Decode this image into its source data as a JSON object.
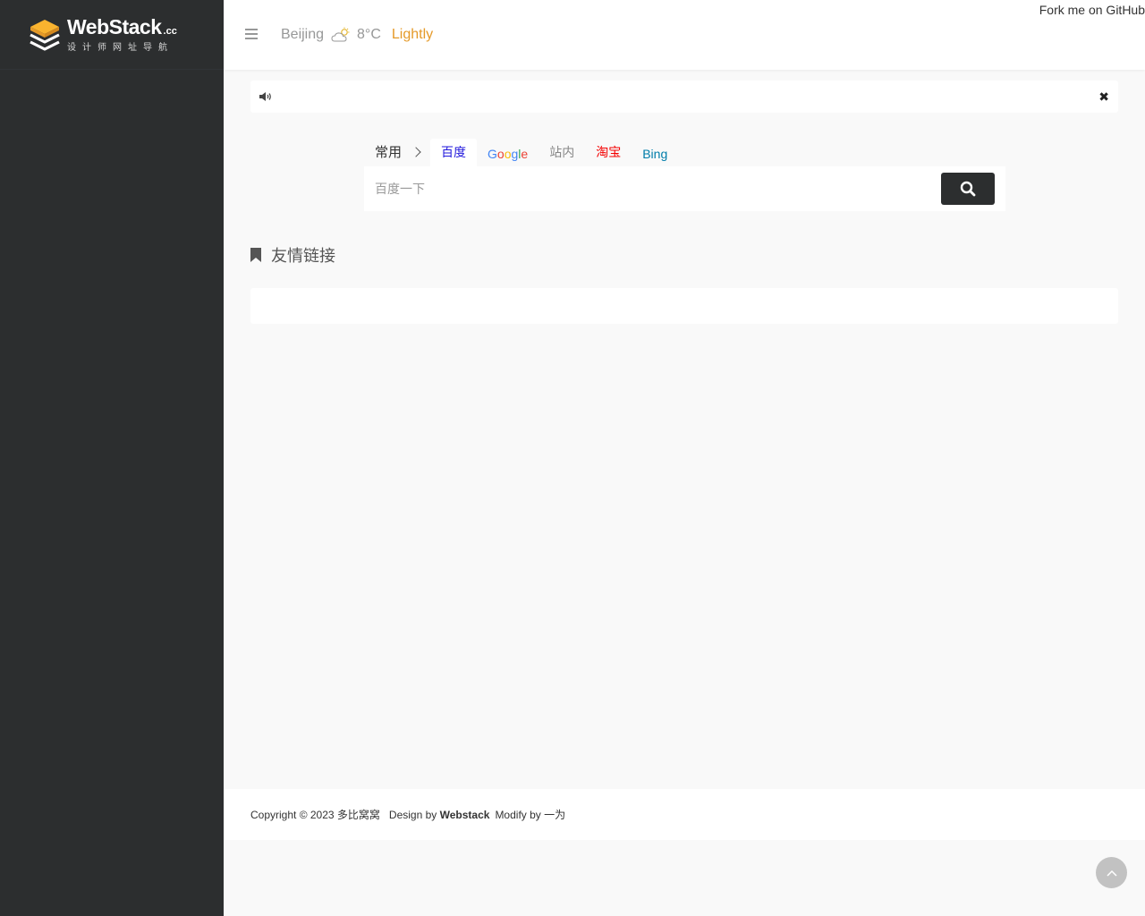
{
  "logo": {
    "main": "WebStack",
    "suffix": ".cc",
    "subtitle": "设计师网址导航"
  },
  "topbar": {
    "menu_icon": "bars-icon",
    "weather": {
      "city": "Beijing",
      "icon": "partly-cloudy-icon",
      "temperature": "8°C",
      "condition": "Lightly"
    },
    "fork_link": "Fork me on GitHub"
  },
  "notice": {
    "icon": "volume-icon",
    "close_icon": "close-icon",
    "close_glyph": "✖"
  },
  "search": {
    "group_label": "常用",
    "tabs": [
      {
        "label": "百度",
        "color": "#2319dc",
        "active": true
      },
      {
        "label": "Google",
        "color": "#4285f4",
        "active": false
      },
      {
        "label": "站内",
        "color": "#888888",
        "active": false
      },
      {
        "label": "淘宝",
        "color": "#f40000",
        "active": false
      },
      {
        "label": "Bing",
        "color": "#007daa",
        "active": false
      }
    ],
    "placeholder": "百度一下",
    "button_icon": "search-icon"
  },
  "section": {
    "icon": "bookmark-icon",
    "title": "友情链接"
  },
  "footer": {
    "copyright": "Copyright © 2023 多比窝窝",
    "design_prefix": "Design by",
    "design_name": "Webstack",
    "modify_prefix": "Modify by",
    "modify_name": "一为"
  },
  "back_to_top_icon": "chevron-up-icon",
  "colors": {
    "sidebar_bg": "#2c2e2f",
    "accent_orange": "#e59a29",
    "page_bg": "#f9f9f9"
  }
}
